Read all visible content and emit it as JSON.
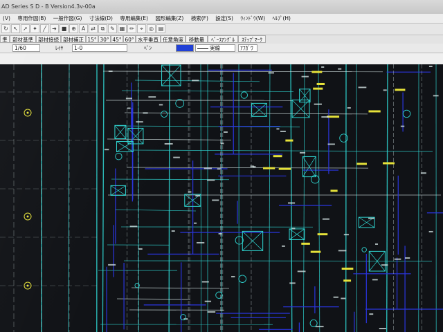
{
  "window": {
    "title": "AD Series S D - B  Version4.3v-00a"
  },
  "menu": {
    "items": [
      {
        "label": "(V)"
      },
      {
        "label": "専用作図(B)"
      },
      {
        "label": "一般作図(G)"
      },
      {
        "label": "寸法線(D)"
      },
      {
        "label": "専用編集(E)"
      },
      {
        "label": "図形編集(Z)"
      },
      {
        "label": "検索(F)"
      },
      {
        "label": "設定(S)"
      },
      {
        "label": "ｳｨﾝﾄﾞｳ(W)"
      },
      {
        "label": "ﾍﾙﾌﾟ(H)"
      }
    ]
  },
  "commands": {
    "items": [
      {
        "label": "準"
      },
      {
        "label": "部材基準"
      },
      {
        "label": "部材接続"
      },
      {
        "label": "部材補正"
      },
      {
        "label": "15°"
      },
      {
        "label": "30°"
      },
      {
        "label": "45°"
      },
      {
        "label": "60°"
      },
      {
        "label": "水平垂直"
      },
      {
        "label": "任意角度"
      },
      {
        "label": "移動量"
      },
      {
        "label": "ﾍﾞｰｽｱﾝｸﾞﾙ"
      },
      {
        "label": "ｽﾃｯﾌﾟﾏｰｸ"
      }
    ]
  },
  "params": {
    "scale": "1/60",
    "layer_label": "ﾚｲﾔ",
    "layer_value": "1-0",
    "pen_label": "ﾍﾟﾝ",
    "pen_color": "#1f3fd6",
    "line_type": "実線",
    "snap_label": "ｱﾌｶﾞﾜ"
  },
  "colors": {
    "cyan": "#2fd6d2",
    "blue": "#2a35e0",
    "yellow": "#e6e23a",
    "white": "#d8e8e8",
    "background": "#101216"
  }
}
